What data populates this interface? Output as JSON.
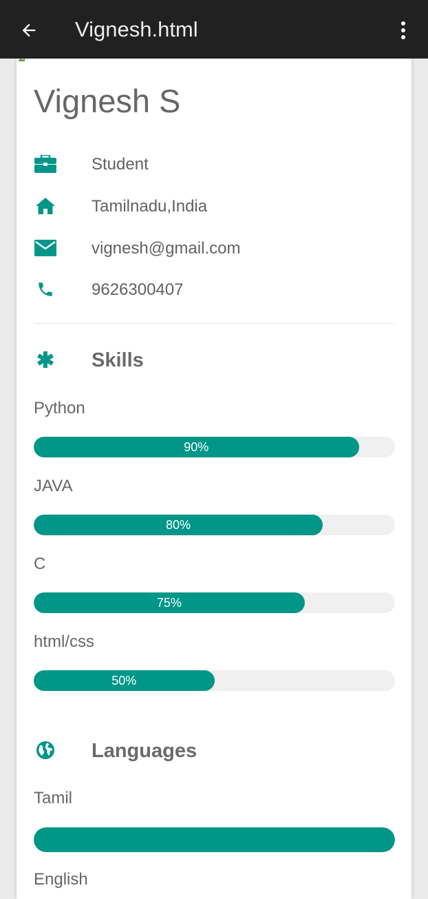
{
  "toolbar": {
    "title": "Vignesh.html",
    "back_icon": "arrow-left-icon",
    "menu_icon": "more-vertical-icon"
  },
  "profile": {
    "name": "Vignesh S",
    "occupation": "Student",
    "location": "Tamilnadu,India",
    "email": "vignesh@gmail.com",
    "phone": "9626300407"
  },
  "skills": {
    "title": "Skills",
    "icon": "asterisk-icon",
    "items": [
      {
        "label": "Python",
        "value": 90,
        "display": "90%"
      },
      {
        "label": "JAVA",
        "value": 80,
        "display": "80%"
      },
      {
        "label": "C",
        "value": 75,
        "display": "75%"
      },
      {
        "label": "html/css",
        "value": 50,
        "display": "50%"
      }
    ]
  },
  "languages": {
    "title": "Languages",
    "icon": "globe-icon",
    "items": [
      {
        "label": "Tamil",
        "value": 100
      },
      {
        "label": "English"
      }
    ]
  },
  "colors": {
    "accent": "#009688",
    "toolbar": "#212121",
    "track": "#f0f0f0"
  }
}
